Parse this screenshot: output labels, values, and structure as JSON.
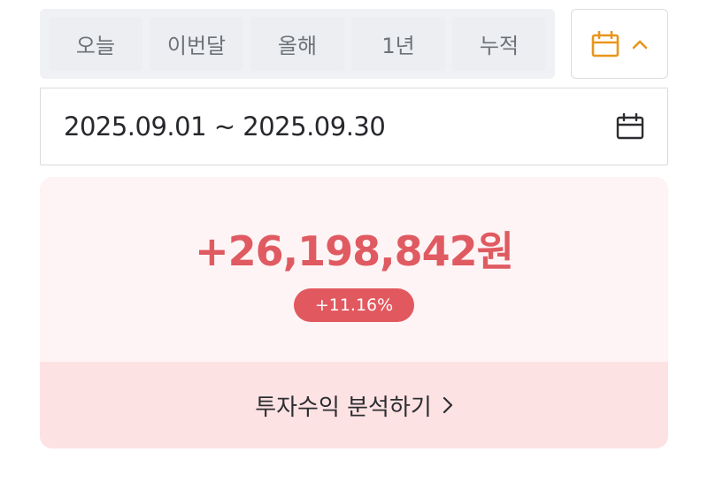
{
  "period_tabs": [
    {
      "label": "오늘"
    },
    {
      "label": "이번달"
    },
    {
      "label": "올해"
    },
    {
      "label": "1년"
    },
    {
      "label": "누적"
    }
  ],
  "calendar_toggle": {
    "icon": "calendar-icon",
    "chevron_icon": "chevron-up-icon",
    "accent_color": "#e8961c"
  },
  "date_range": {
    "value": "2025.09.01 ~ 2025.09.30",
    "icon": "calendar-icon"
  },
  "profit": {
    "amount": "+26,198,842원",
    "rate": "+11.16%",
    "color": "#e05a61"
  },
  "analysis": {
    "label": "투자수익 분석하기",
    "icon": "chevron-right-icon"
  }
}
